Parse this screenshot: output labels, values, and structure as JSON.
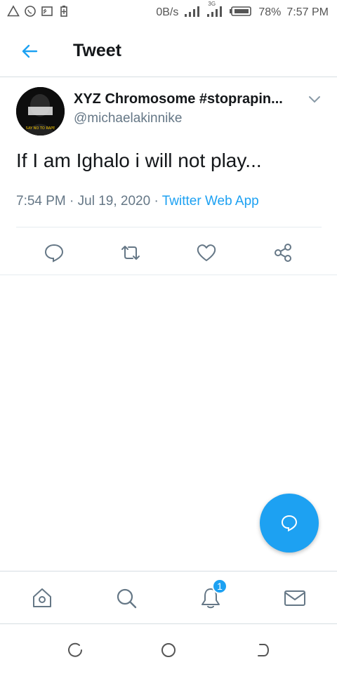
{
  "status_bar": {
    "net_speed": "0B/s",
    "network_type": "3G",
    "battery": "78%",
    "time": "7:57 PM",
    "icons": [
      "alert-icon",
      "whatsapp-icon",
      "cast-icon",
      "battery-saver-icon",
      "signal-icon",
      "signal-3g-icon",
      "battery-icon"
    ]
  },
  "app_bar": {
    "title": "Tweet"
  },
  "tweet": {
    "author_name": "XYZ Chromosome #stoprapin...",
    "author_handle": "@michaelakinnike",
    "text": "If I am Ighalo i will not play...",
    "time": "7:54 PM",
    "date": "Jul 19, 2020",
    "separator": "·",
    "source": "Twitter Web App",
    "avatar_caption": "SAY NO TO RAPE"
  },
  "bottom_nav": {
    "notifications_badge": "1",
    "items": [
      "home-icon",
      "search-icon",
      "notifications-icon",
      "messages-icon"
    ]
  },
  "colors": {
    "accent": "#1da1f2",
    "text": "#14171a",
    "secondary": "#657786",
    "divider": "#e6ecf0"
  }
}
